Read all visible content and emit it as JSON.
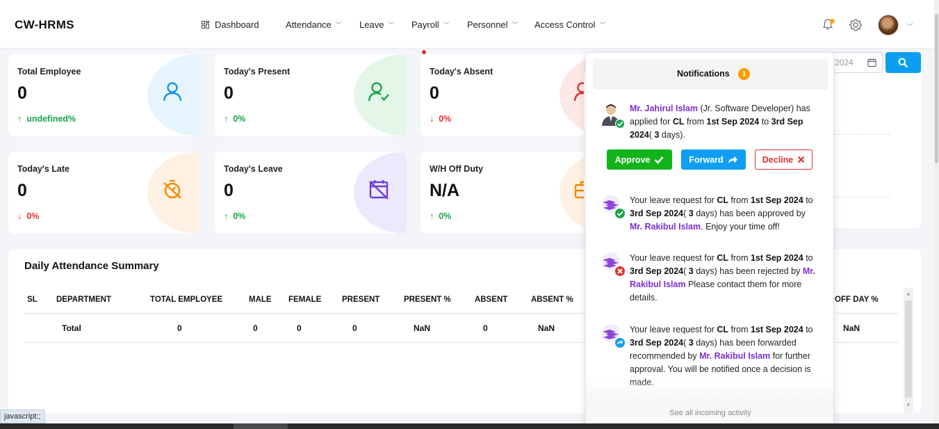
{
  "app": {
    "brand": "CW-HRMS"
  },
  "nav": {
    "dashboard": "Dashboard",
    "attendance": "Attendance",
    "leave": "Leave",
    "payroll": "Payroll",
    "personnel": "Personnel",
    "access_control": "Access Control"
  },
  "header_icons": [
    "bell-icon",
    "gear-icon",
    "avatar",
    "chevron-down-icon"
  ],
  "cards": [
    {
      "title": "Total Employee",
      "value": "0",
      "change": "undefined%",
      "trend": "up",
      "icon": "user-icon",
      "color": "#e6f4fd"
    },
    {
      "title": "Today's Present",
      "value": "0",
      "change": "0%",
      "trend": "up",
      "icon": "user-check-icon",
      "color": "#e3f6e8"
    },
    {
      "title": "Today's Absent",
      "value": "0",
      "change": "0%",
      "trend": "down",
      "icon": "user-x-icon",
      "color": "#fde8e8"
    },
    {
      "title": "Today's Late",
      "value": "0",
      "change": "0%",
      "trend": "down",
      "icon": "timer-icon",
      "color": "#fef0e3"
    },
    {
      "title": "Today's Leave",
      "value": "0",
      "change": "0%",
      "trend": "up",
      "icon": "calendar-off-icon",
      "color": "#ece9fd"
    },
    {
      "title": "W/H Off Duty",
      "value": "N/A",
      "change": "0%",
      "trend": "up",
      "icon": "briefcase-icon",
      "color": "#fef0e3"
    }
  ],
  "arrows": {
    "up": "↑",
    "down": "↓"
  },
  "filter": {
    "date_fragment": "2024"
  },
  "summary": {
    "title": "Daily Attendance Summary",
    "columns": [
      "SL",
      "DEPARTMENT",
      "TOTAL EMPLOYEE",
      "MALE",
      "FEMALE",
      "PRESENT",
      "PRESENT %",
      "ABSENT",
      "ABSENT %",
      "OFF DAY %"
    ],
    "total_row": {
      "department": "Total",
      "total_employee": "0",
      "male": "0",
      "female": "0",
      "present": "0",
      "present_pct": "NaN",
      "absent": "0",
      "absent_pct": "NaN",
      "off_day_pct": "NaN"
    }
  },
  "notifications": {
    "title": "Notifications",
    "count": "1",
    "items": [
      {
        "name": "Mr. Jahirul Islam",
        "role": "(Jr. Software Developer) has applied for",
        "type": "CL",
        "from_word": "from",
        "from": "1st Sep 2024",
        "to_word": "to",
        "to": "3rd Sep 2024",
        "days_pre": "(",
        "days": "3",
        "days_post": "days).",
        "icon": "employee-avatar-icon"
      },
      {
        "pre": "Your leave request for",
        "type": "CL",
        "from": "1st Sep 2024",
        "to": "3rd Sep 2024",
        "days": "3",
        "mid": "days) has been approved by",
        "name": "Mr. Rakibul Islam",
        "post": ". Enjoy your time off!",
        "icon": "approved-icon"
      },
      {
        "pre": "Your leave request for",
        "type": "CL",
        "from": "1st Sep 2024",
        "to": "3rd Sep 2024",
        "days": "3",
        "mid": "days) has been rejected by",
        "name": "Mr. Rakibul Islam",
        "post": "Please contact them for more details.",
        "icon": "rejected-icon"
      },
      {
        "pre": "Your leave request for",
        "type": "CL",
        "from": "1st Sep 2024",
        "to": "3rd Sep 2024",
        "days": "3",
        "mid": "days) has been forwarded recommended by",
        "name": "Mr. Rakibul Islam",
        "post": "for further approval. You will be notified once a decision is made.",
        "icon": "forwarded-icon"
      }
    ],
    "actions": {
      "approve": "Approve",
      "forward": "Forward",
      "decline": "Decline"
    },
    "see_all": "See all incoming activity"
  },
  "status_bar": {
    "link": "javascript:;"
  }
}
